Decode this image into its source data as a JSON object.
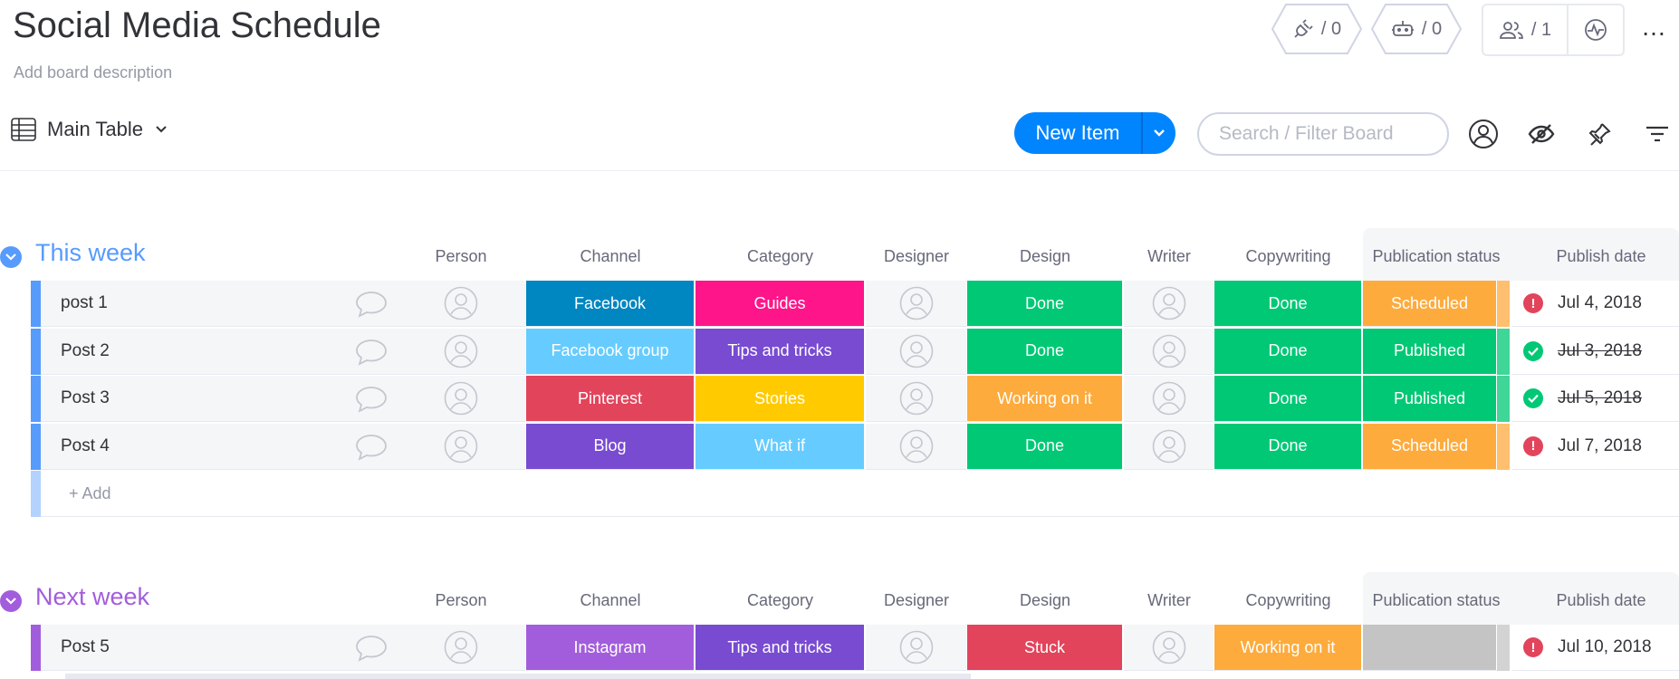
{
  "board": {
    "title": "Social Media Schedule",
    "description": "Add board description",
    "integrations_count": "/ 0",
    "automations_count": "/ 0",
    "members_count": "/ 1",
    "more": "…"
  },
  "toolbar": {
    "view_label": "Main Table",
    "new_item_label": "New Item",
    "search_placeholder": "Search / Filter Board"
  },
  "columns": {
    "person": "Person",
    "channel": "Channel",
    "category": "Category",
    "designer": "Designer",
    "design": "Design",
    "writer": "Writer",
    "copywriting": "Copywriting",
    "publication_status": "Publication status",
    "publish_date": "Publish date"
  },
  "colors": {
    "done": "#00c875",
    "scheduled": "#fdab3d",
    "published": "#00c875",
    "stuck": "#e2445c",
    "working": "#fdab3d",
    "alert_red": "#e2445c",
    "check_green": "#00c875",
    "this_week": "#579bfc",
    "next_week": "#a25ddc"
  },
  "groups": [
    {
      "title": "This week",
      "add_label": "+ Add",
      "rows": [
        {
          "name": "post 1",
          "channel": "Facebook",
          "channel_color": "#0086c0",
          "category": "Guides",
          "category_color": "#ff158a",
          "design": "Done",
          "design_color": "#00c875",
          "copy": "Done",
          "copy_color": "#00c875",
          "status": "Scheduled",
          "status_color": "#fdab3d",
          "date_icon": "alert",
          "date": "Jul 4, 2018",
          "strike": false
        },
        {
          "name": "Post 2",
          "channel": "Facebook group",
          "channel_color": "#66ccff",
          "category": "Tips and tricks",
          "category_color": "#784bd1",
          "design": "Done",
          "design_color": "#00c875",
          "copy": "Done",
          "copy_color": "#00c875",
          "status": "Published",
          "status_color": "#00c875",
          "date_icon": "check",
          "date": "Jul 3, 2018",
          "strike": true
        },
        {
          "name": "Post 3",
          "channel": "Pinterest",
          "channel_color": "#e2445c",
          "category": "Stories",
          "category_color": "#ffcb00",
          "design": "Working on it",
          "design_color": "#fdab3d",
          "copy": "Done",
          "copy_color": "#00c875",
          "status": "Published",
          "status_color": "#00c875",
          "date_icon": "check",
          "date": "Jul 5, 2018",
          "strike": true
        },
        {
          "name": "Post 4",
          "channel": "Blog",
          "channel_color": "#784bd1",
          "category": "What if",
          "category_color": "#66ccff",
          "design": "Done",
          "design_color": "#00c875",
          "copy": "Done",
          "copy_color": "#00c875",
          "status": "Scheduled",
          "status_color": "#fdab3d",
          "date_icon": "alert",
          "date": "Jul 7, 2018",
          "strike": false
        }
      ]
    },
    {
      "title": "Next week",
      "rows": [
        {
          "name": "Post 5",
          "channel": "Instagram",
          "channel_color": "#a25ddc",
          "category": "Tips and tricks",
          "category_color": "#784bd1",
          "design": "Stuck",
          "design_color": "#e2445c",
          "copy": "Working on it",
          "copy_color": "#fdab3d",
          "status": "",
          "status_color": "#c4c4c4",
          "date_icon": "alert",
          "date": "Jul 10, 2018",
          "strike": false
        }
      ]
    }
  ]
}
